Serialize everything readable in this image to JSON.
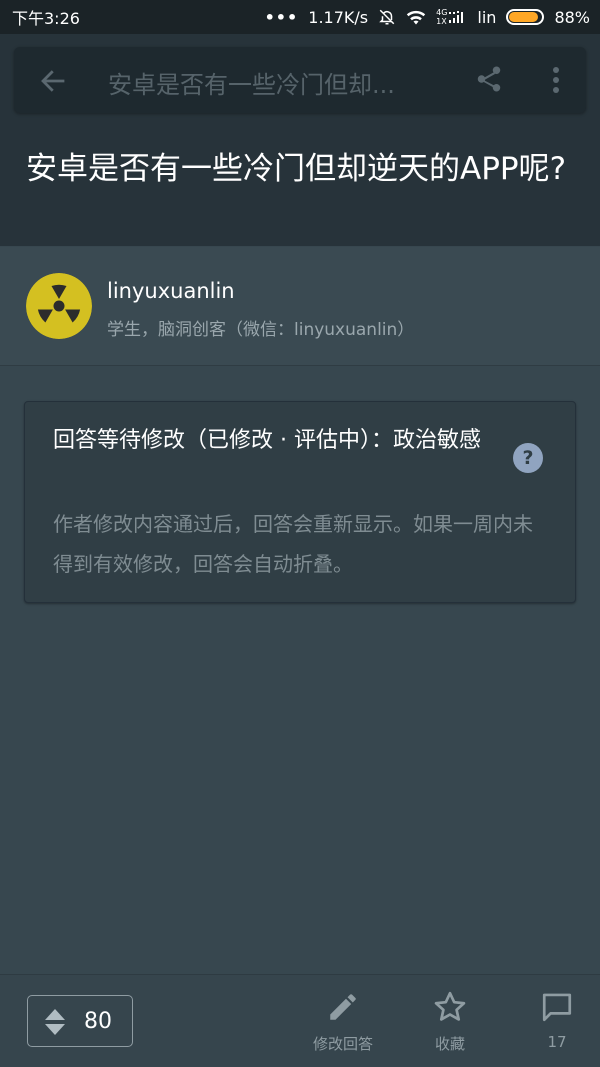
{
  "status_bar": {
    "time": "下午3:26",
    "more": "•••",
    "speed": "1.17K/s",
    "net_4g": "4G",
    "net_1x": "1X",
    "carrier": "lin",
    "battery_percent": "88%",
    "battery_level": 0.88,
    "battery_color": "#ffa726"
  },
  "toolbar": {
    "back_icon": "arrow-left-icon",
    "title": "安卓是否有一些冷门但却...",
    "share_icon": "share-icon",
    "more_icon": "more-vertical-icon"
  },
  "question": {
    "title": "安卓是否有一些冷门但却逆天的APP呢?"
  },
  "author": {
    "name": "linyuxuanlin",
    "bio": "学生，脑洞创客（微信：linyuxuanlin）",
    "avatar_icon": "radiation-icon",
    "avatar_color": "#d4c021"
  },
  "notice": {
    "title": "回答等待修改（已修改 · 评估中）：政治敏感",
    "body": "作者修改内容通过后，回答会重新显示。如果一周内未得到有效修改，回答会自动折叠。",
    "help_symbol": "?"
  },
  "bottom_bar": {
    "vote_count": "80",
    "edit_label": "修改回答",
    "favorite_label": "收藏",
    "comment_count": "17"
  }
}
